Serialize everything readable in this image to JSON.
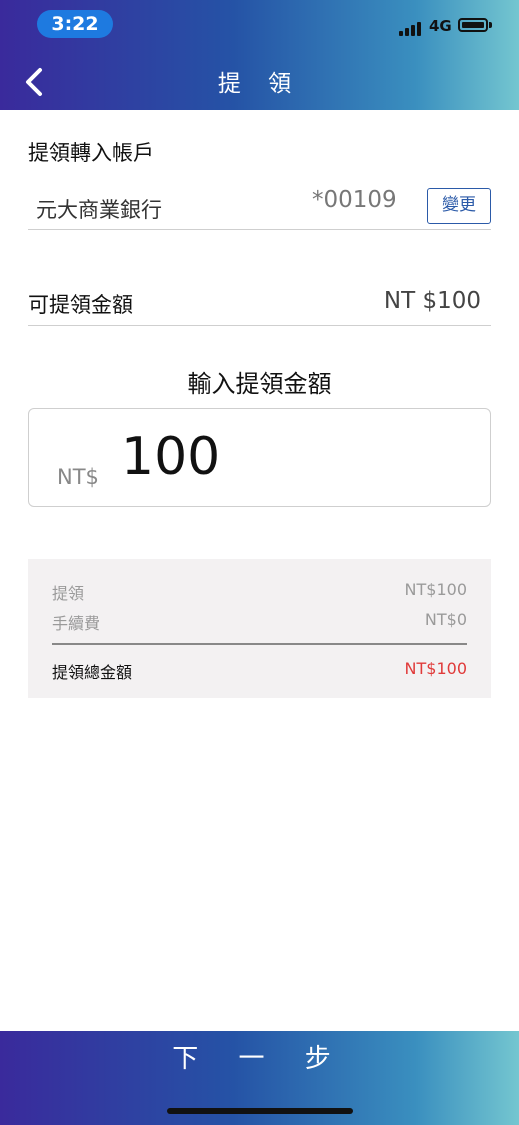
{
  "status_bar": {
    "time": "3:22",
    "network": "4G"
  },
  "header": {
    "title": "提 領"
  },
  "account": {
    "label": "提領轉入帳戶",
    "bank_name": "元大商業銀行",
    "account_number": "*00109",
    "change_label": "變更"
  },
  "available": {
    "label": "可提領金額",
    "value": "NT $100"
  },
  "input": {
    "label": "輸入提領金額",
    "currency": "NT$",
    "amount": "100"
  },
  "summary": {
    "withdraw_label": "提領",
    "withdraw_value": "NT$100",
    "fee_label": "手續費",
    "fee_value": "NT$0",
    "total_label": "提領總金額",
    "total_value": "NT$100",
    "total_color": "#e03a3a"
  },
  "footer": {
    "next_label": "下 一 步"
  },
  "colors": {
    "accent": "#2b5aa8",
    "gradient_start": "#3a2a9c",
    "gradient_end": "#74c6d0"
  }
}
